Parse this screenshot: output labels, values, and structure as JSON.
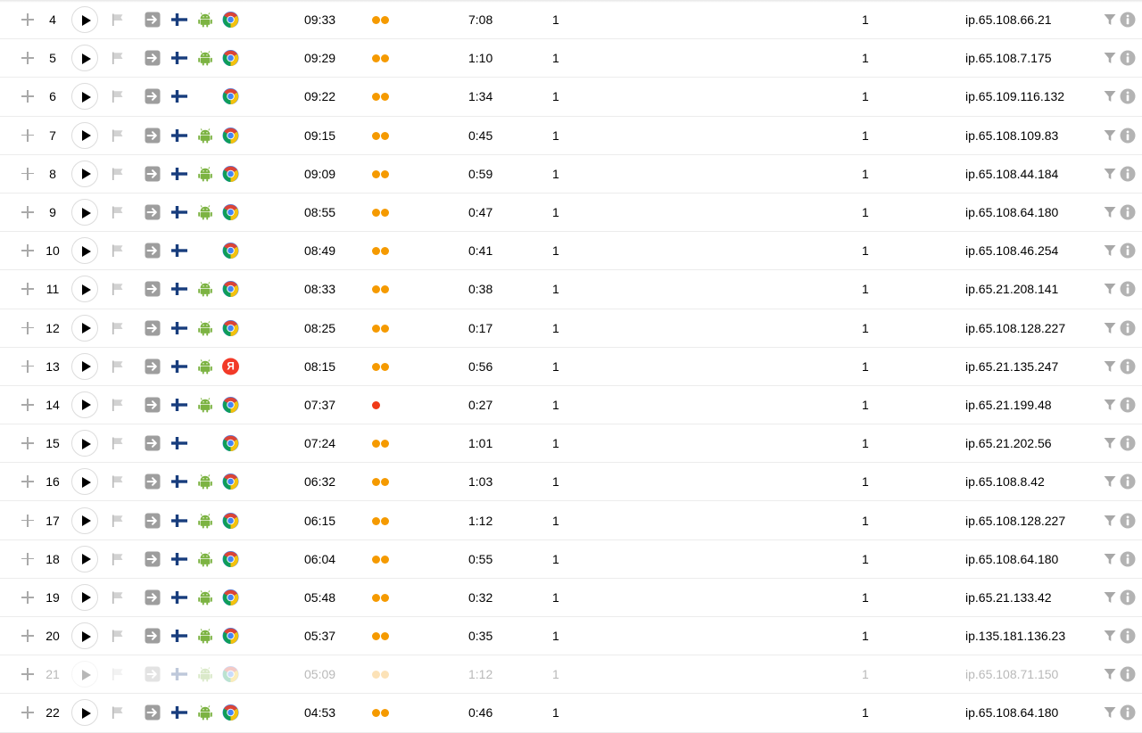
{
  "colors": {
    "dot_orange": "#f59a00",
    "dot_red": "#f03a17",
    "android_green": "#7cb342",
    "chrome_red": "#db4437",
    "chrome_yellow": "#f4c20d",
    "chrome_green": "#0f9d58",
    "chrome_blue": "#4285f4",
    "yandex_red": "#f23a28",
    "finland_blue": "#183d7d",
    "icon_gray": "#a8a8a8"
  },
  "icons": {
    "expand": "plus-icon",
    "play": "play-icon",
    "bookmark": "flag-icon",
    "traffic_source": "arrow-right-icon",
    "country": "finland-flag-icon",
    "os": "android-icon",
    "filter": "funnel-filter-icon",
    "details": "info-icon"
  },
  "rows": [
    {
      "num": "4",
      "time": "09:33",
      "dots": 2,
      "dot_color": "orange",
      "duration": "7:08",
      "col1": "1",
      "col2": "1",
      "ip": "ip.65.108.66.21",
      "os": "android",
      "browser": "chrome",
      "faded": false
    },
    {
      "num": "5",
      "time": "09:29",
      "dots": 2,
      "dot_color": "orange",
      "duration": "1:10",
      "col1": "1",
      "col2": "1",
      "ip": "ip.65.108.7.175",
      "os": "android",
      "browser": "chrome",
      "faded": false
    },
    {
      "num": "6",
      "time": "09:22",
      "dots": 2,
      "dot_color": "orange",
      "duration": "1:34",
      "col1": "1",
      "col2": "1",
      "ip": "ip.65.109.116.132",
      "os": "",
      "browser": "chrome",
      "faded": false
    },
    {
      "num": "7",
      "time": "09:15",
      "dots": 2,
      "dot_color": "orange",
      "duration": "0:45",
      "col1": "1",
      "col2": "1",
      "ip": "ip.65.108.109.83",
      "os": "android",
      "browser": "chrome",
      "faded": false
    },
    {
      "num": "8",
      "time": "09:09",
      "dots": 2,
      "dot_color": "orange",
      "duration": "0:59",
      "col1": "1",
      "col2": "1",
      "ip": "ip.65.108.44.184",
      "os": "android",
      "browser": "chrome",
      "faded": false
    },
    {
      "num": "9",
      "time": "08:55",
      "dots": 2,
      "dot_color": "orange",
      "duration": "0:47",
      "col1": "1",
      "col2": "1",
      "ip": "ip.65.108.64.180",
      "os": "android",
      "browser": "chrome",
      "faded": false
    },
    {
      "num": "10",
      "time": "08:49",
      "dots": 2,
      "dot_color": "orange",
      "duration": "0:41",
      "col1": "1",
      "col2": "1",
      "ip": "ip.65.108.46.254",
      "os": "",
      "browser": "chrome",
      "faded": false
    },
    {
      "num": "11",
      "time": "08:33",
      "dots": 2,
      "dot_color": "orange",
      "duration": "0:38",
      "col1": "1",
      "col2": "1",
      "ip": "ip.65.21.208.141",
      "os": "android",
      "browser": "chrome",
      "faded": false
    },
    {
      "num": "12",
      "time": "08:25",
      "dots": 2,
      "dot_color": "orange",
      "duration": "0:17",
      "col1": "1",
      "col2": "1",
      "ip": "ip.65.108.128.227",
      "os": "android",
      "browser": "chrome",
      "faded": false
    },
    {
      "num": "13",
      "time": "08:15",
      "dots": 2,
      "dot_color": "orange",
      "duration": "0:56",
      "col1": "1",
      "col2": "1",
      "ip": "ip.65.21.135.247",
      "os": "android",
      "browser": "yandex",
      "faded": false
    },
    {
      "num": "14",
      "time": "07:37",
      "dots": 1,
      "dot_color": "red",
      "duration": "0:27",
      "col1": "1",
      "col2": "1",
      "ip": "ip.65.21.199.48",
      "os": "android",
      "browser": "chrome",
      "faded": false
    },
    {
      "num": "15",
      "time": "07:24",
      "dots": 2,
      "dot_color": "orange",
      "duration": "1:01",
      "col1": "1",
      "col2": "1",
      "ip": "ip.65.21.202.56",
      "os": "",
      "browser": "chrome",
      "faded": false
    },
    {
      "num": "16",
      "time": "06:32",
      "dots": 2,
      "dot_color": "orange",
      "duration": "1:03",
      "col1": "1",
      "col2": "1",
      "ip": "ip.65.108.8.42",
      "os": "android",
      "browser": "chrome",
      "faded": false
    },
    {
      "num": "17",
      "time": "06:15",
      "dots": 2,
      "dot_color": "orange",
      "duration": "1:12",
      "col1": "1",
      "col2": "1",
      "ip": "ip.65.108.128.227",
      "os": "android",
      "browser": "chrome",
      "faded": false
    },
    {
      "num": "18",
      "time": "06:04",
      "dots": 2,
      "dot_color": "orange",
      "duration": "0:55",
      "col1": "1",
      "col2": "1",
      "ip": "ip.65.108.64.180",
      "os": "android",
      "browser": "chrome",
      "faded": false
    },
    {
      "num": "19",
      "time": "05:48",
      "dots": 2,
      "dot_color": "orange",
      "duration": "0:32",
      "col1": "1",
      "col2": "1",
      "ip": "ip.65.21.133.42",
      "os": "android",
      "browser": "chrome",
      "faded": false
    },
    {
      "num": "20",
      "time": "05:37",
      "dots": 2,
      "dot_color": "orange",
      "duration": "0:35",
      "col1": "1",
      "col2": "1",
      "ip": "ip.135.181.136.23",
      "os": "android",
      "browser": "chrome",
      "faded": false
    },
    {
      "num": "21",
      "time": "05:09",
      "dots": 2,
      "dot_color": "orange",
      "duration": "1:12",
      "col1": "1",
      "col2": "1",
      "ip": "ip.65.108.71.150",
      "os": "android",
      "browser": "chrome",
      "faded": true
    },
    {
      "num": "22",
      "time": "04:53",
      "dots": 2,
      "dot_color": "orange",
      "duration": "0:46",
      "col1": "1",
      "col2": "1",
      "ip": "ip.65.108.64.180",
      "os": "android",
      "browser": "chrome",
      "faded": false
    }
  ]
}
